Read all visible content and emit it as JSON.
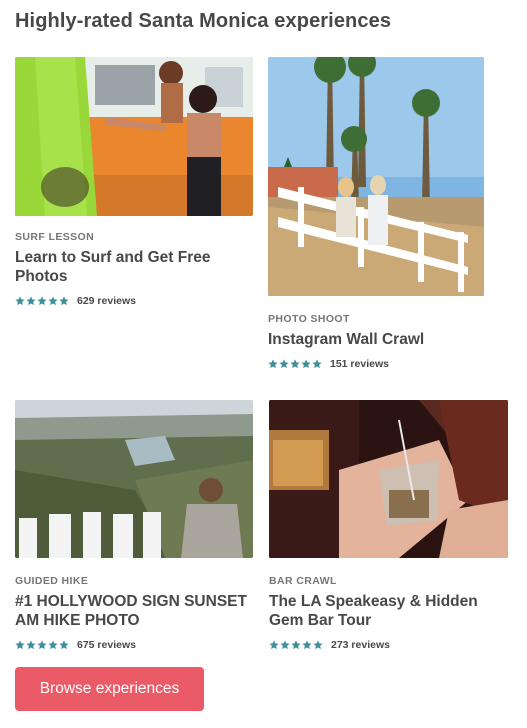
{
  "section": {
    "title": "Highly-rated Santa Monica experiences"
  },
  "colors": {
    "star": "#3f8f99",
    "button": "#ea5b67",
    "category": "#767676",
    "text": "#484848"
  },
  "experiences": [
    {
      "category": "SURF LESSON",
      "title": "Learn to Surf and Get Free Photos",
      "rating": 5,
      "reviews": "629 reviews",
      "image_icon": "surf-photo"
    },
    {
      "category": "PHOTO SHOOT",
      "title": "Instagram Wall Crawl",
      "rating": 5,
      "reviews": "151 reviews",
      "image_icon": "pier-photo"
    },
    {
      "category": "GUIDED HIKE",
      "title": "#1 HOLLYWOOD SIGN SUNSET AM HIKE PHOTO",
      "rating": 5,
      "reviews": "675 reviews",
      "image_icon": "hollywood-photo"
    },
    {
      "category": "BAR CRAWL",
      "title": "The LA Speakeasy & Hidden Gem Bar Tour",
      "rating": 5,
      "reviews": "273 reviews",
      "image_icon": "cocktail-photo"
    }
  ],
  "button": {
    "label": "Browse experiences"
  }
}
